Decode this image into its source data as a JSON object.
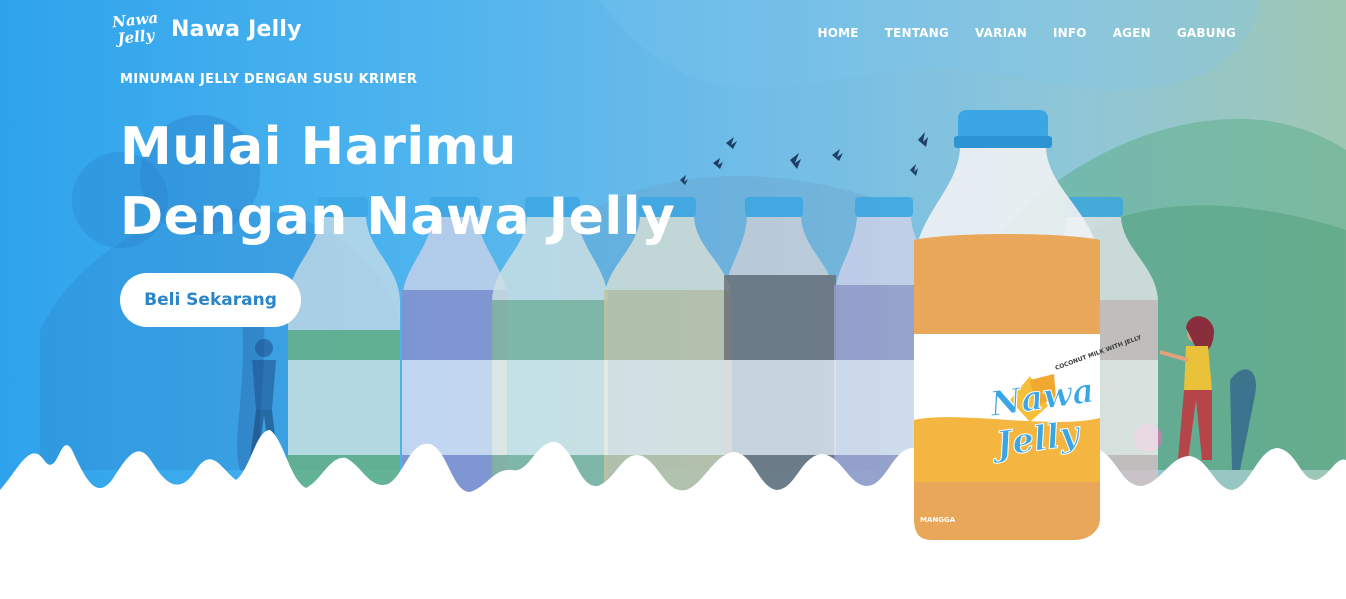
{
  "brand": {
    "logo_line1": "Nawa",
    "logo_line2": "Jelly",
    "name": "Nawa Jelly"
  },
  "nav": {
    "items": [
      {
        "label": "HOME"
      },
      {
        "label": "TENTANG"
      },
      {
        "label": "VARIAN"
      },
      {
        "label": "INFO"
      },
      {
        "label": "AGEN"
      },
      {
        "label": "GABUNG"
      }
    ]
  },
  "hero": {
    "tagline": "MINUMAN JELLY DENGAN SUSU KRIMER",
    "headline_line1": "Mulai Harimu",
    "headline_line2": "Dengan Nawa Jelly",
    "cta_label": "Beli Sekarang"
  },
  "product": {
    "label_line1": "Nawa",
    "label_line2": "Jelly",
    "side_text": "COCONUT MILK WITH JELLY",
    "flavor_text": "MANGGA"
  },
  "colors": {
    "accent": "#2a86c9",
    "bottle_cap": "#3aa6e4",
    "bottle_drink": "#e9a75a"
  }
}
